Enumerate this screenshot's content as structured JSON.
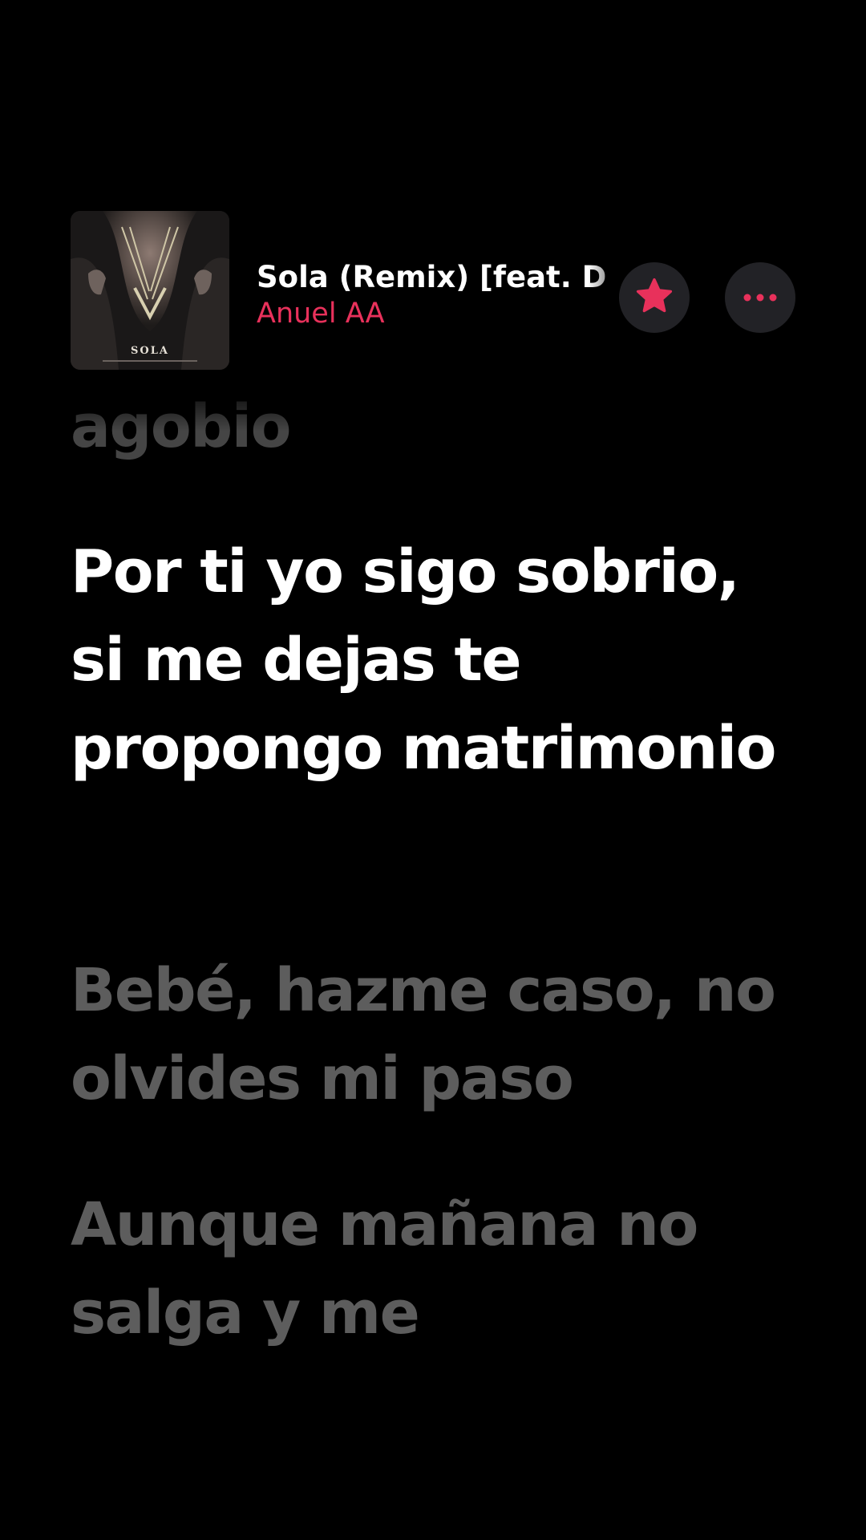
{
  "now_playing": {
    "artwork_text": "SOLA",
    "title": "Sola (Remix) [feat. D",
    "artist": "Anuel AA",
    "favorite_icon": "star-icon",
    "more_icon": "ellipsis-icon"
  },
  "lyrics": {
    "previous": "agobio",
    "current": "Por ti yo sigo sobrio, si me dejas te propongo matrimonio",
    "upcoming": [
      "Bebé, hazme caso, no olvides mi paso",
      "Aunque mañana no salga y me"
    ]
  },
  "colors": {
    "background": "#000000",
    "accent": "#e8315b",
    "lyric_active": "#ffffff",
    "lyric_inactive": "#5d5d5d",
    "button_bg": "#222226"
  }
}
